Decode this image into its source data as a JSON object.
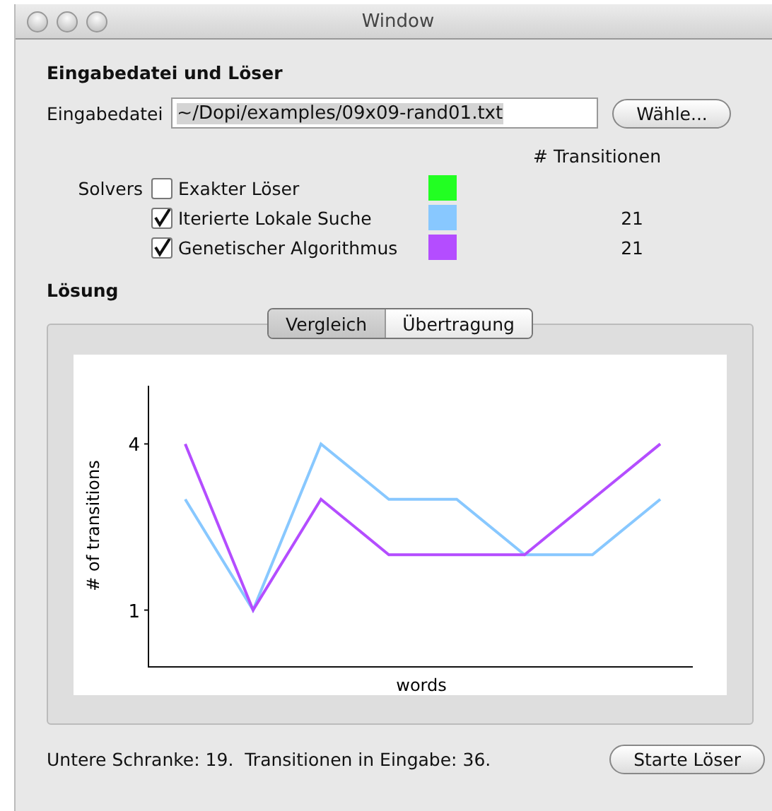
{
  "window": {
    "title": "Window"
  },
  "input_section": {
    "title": "Eingabedatei und Löser",
    "file_label": "Eingabedatei",
    "file_value": "~/Dopi/examples/09x09-rand01.txt",
    "choose_button": "Wähle..."
  },
  "solvers": {
    "label": "Solvers",
    "count_header": "# Transitionen",
    "items": [
      {
        "name": "Exakter Löser",
        "checked": false,
        "color": "#22ff22"
      },
      {
        "name": "Iterierte Lokale Suche",
        "checked": true,
        "color": "#88c8ff",
        "count": "21"
      },
      {
        "name": "Genetischer Algorithmus",
        "checked": true,
        "color": "#b44dff",
        "count": "21"
      }
    ]
  },
  "solution": {
    "title": "Lösung",
    "tabs": [
      {
        "label": "Vergleich",
        "selected": true
      },
      {
        "label": "Übertragung",
        "selected": false
      }
    ],
    "chart_data": {
      "type": "line",
      "xlabel": "words",
      "ylabel": "# of transitions",
      "ylim": [
        0,
        5
      ],
      "yticks": [
        1,
        4
      ],
      "series": [
        {
          "color": "#88c8ff",
          "values": [
            3,
            1,
            4,
            3,
            3,
            2,
            2,
            3
          ]
        },
        {
          "color": "#b44dff",
          "values": [
            4,
            1,
            3,
            2,
            2,
            2,
            3,
            4
          ]
        }
      ]
    }
  },
  "status_text": "Untere Schranke: 19.  Transitionen in Eingabe: 36.",
  "start_button": "Starte Löser"
}
